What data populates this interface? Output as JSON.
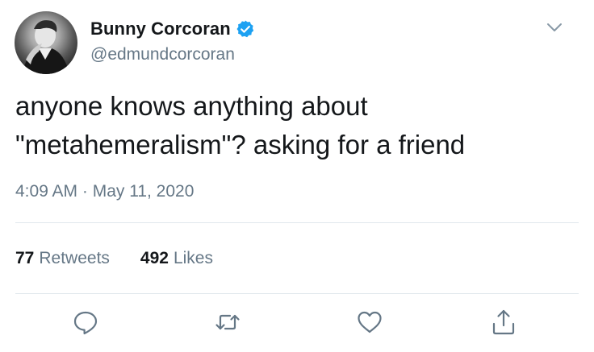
{
  "user": {
    "display_name": "Bunny Corcoran",
    "handle": "@edmundcorcoran",
    "verified": true,
    "avatar": "profile-photo"
  },
  "tweet": {
    "text": "anyone knows anything about\n\"metahemeralism\"? asking for a friend",
    "timestamp": "4:09 AM · May 11, 2020"
  },
  "stats": {
    "retweets_count": "77",
    "retweets_label": "Retweets",
    "likes_count": "492",
    "likes_label": "Likes"
  },
  "actions": {
    "items": [
      "reply-icon",
      "retweet-icon",
      "like-icon",
      "share-icon"
    ]
  },
  "colors": {
    "text_primary": "#14171a",
    "text_secondary": "#657786",
    "verified_blue": "#1da1f2",
    "divider": "#e1e8ed",
    "icon_gray": "#657786"
  }
}
